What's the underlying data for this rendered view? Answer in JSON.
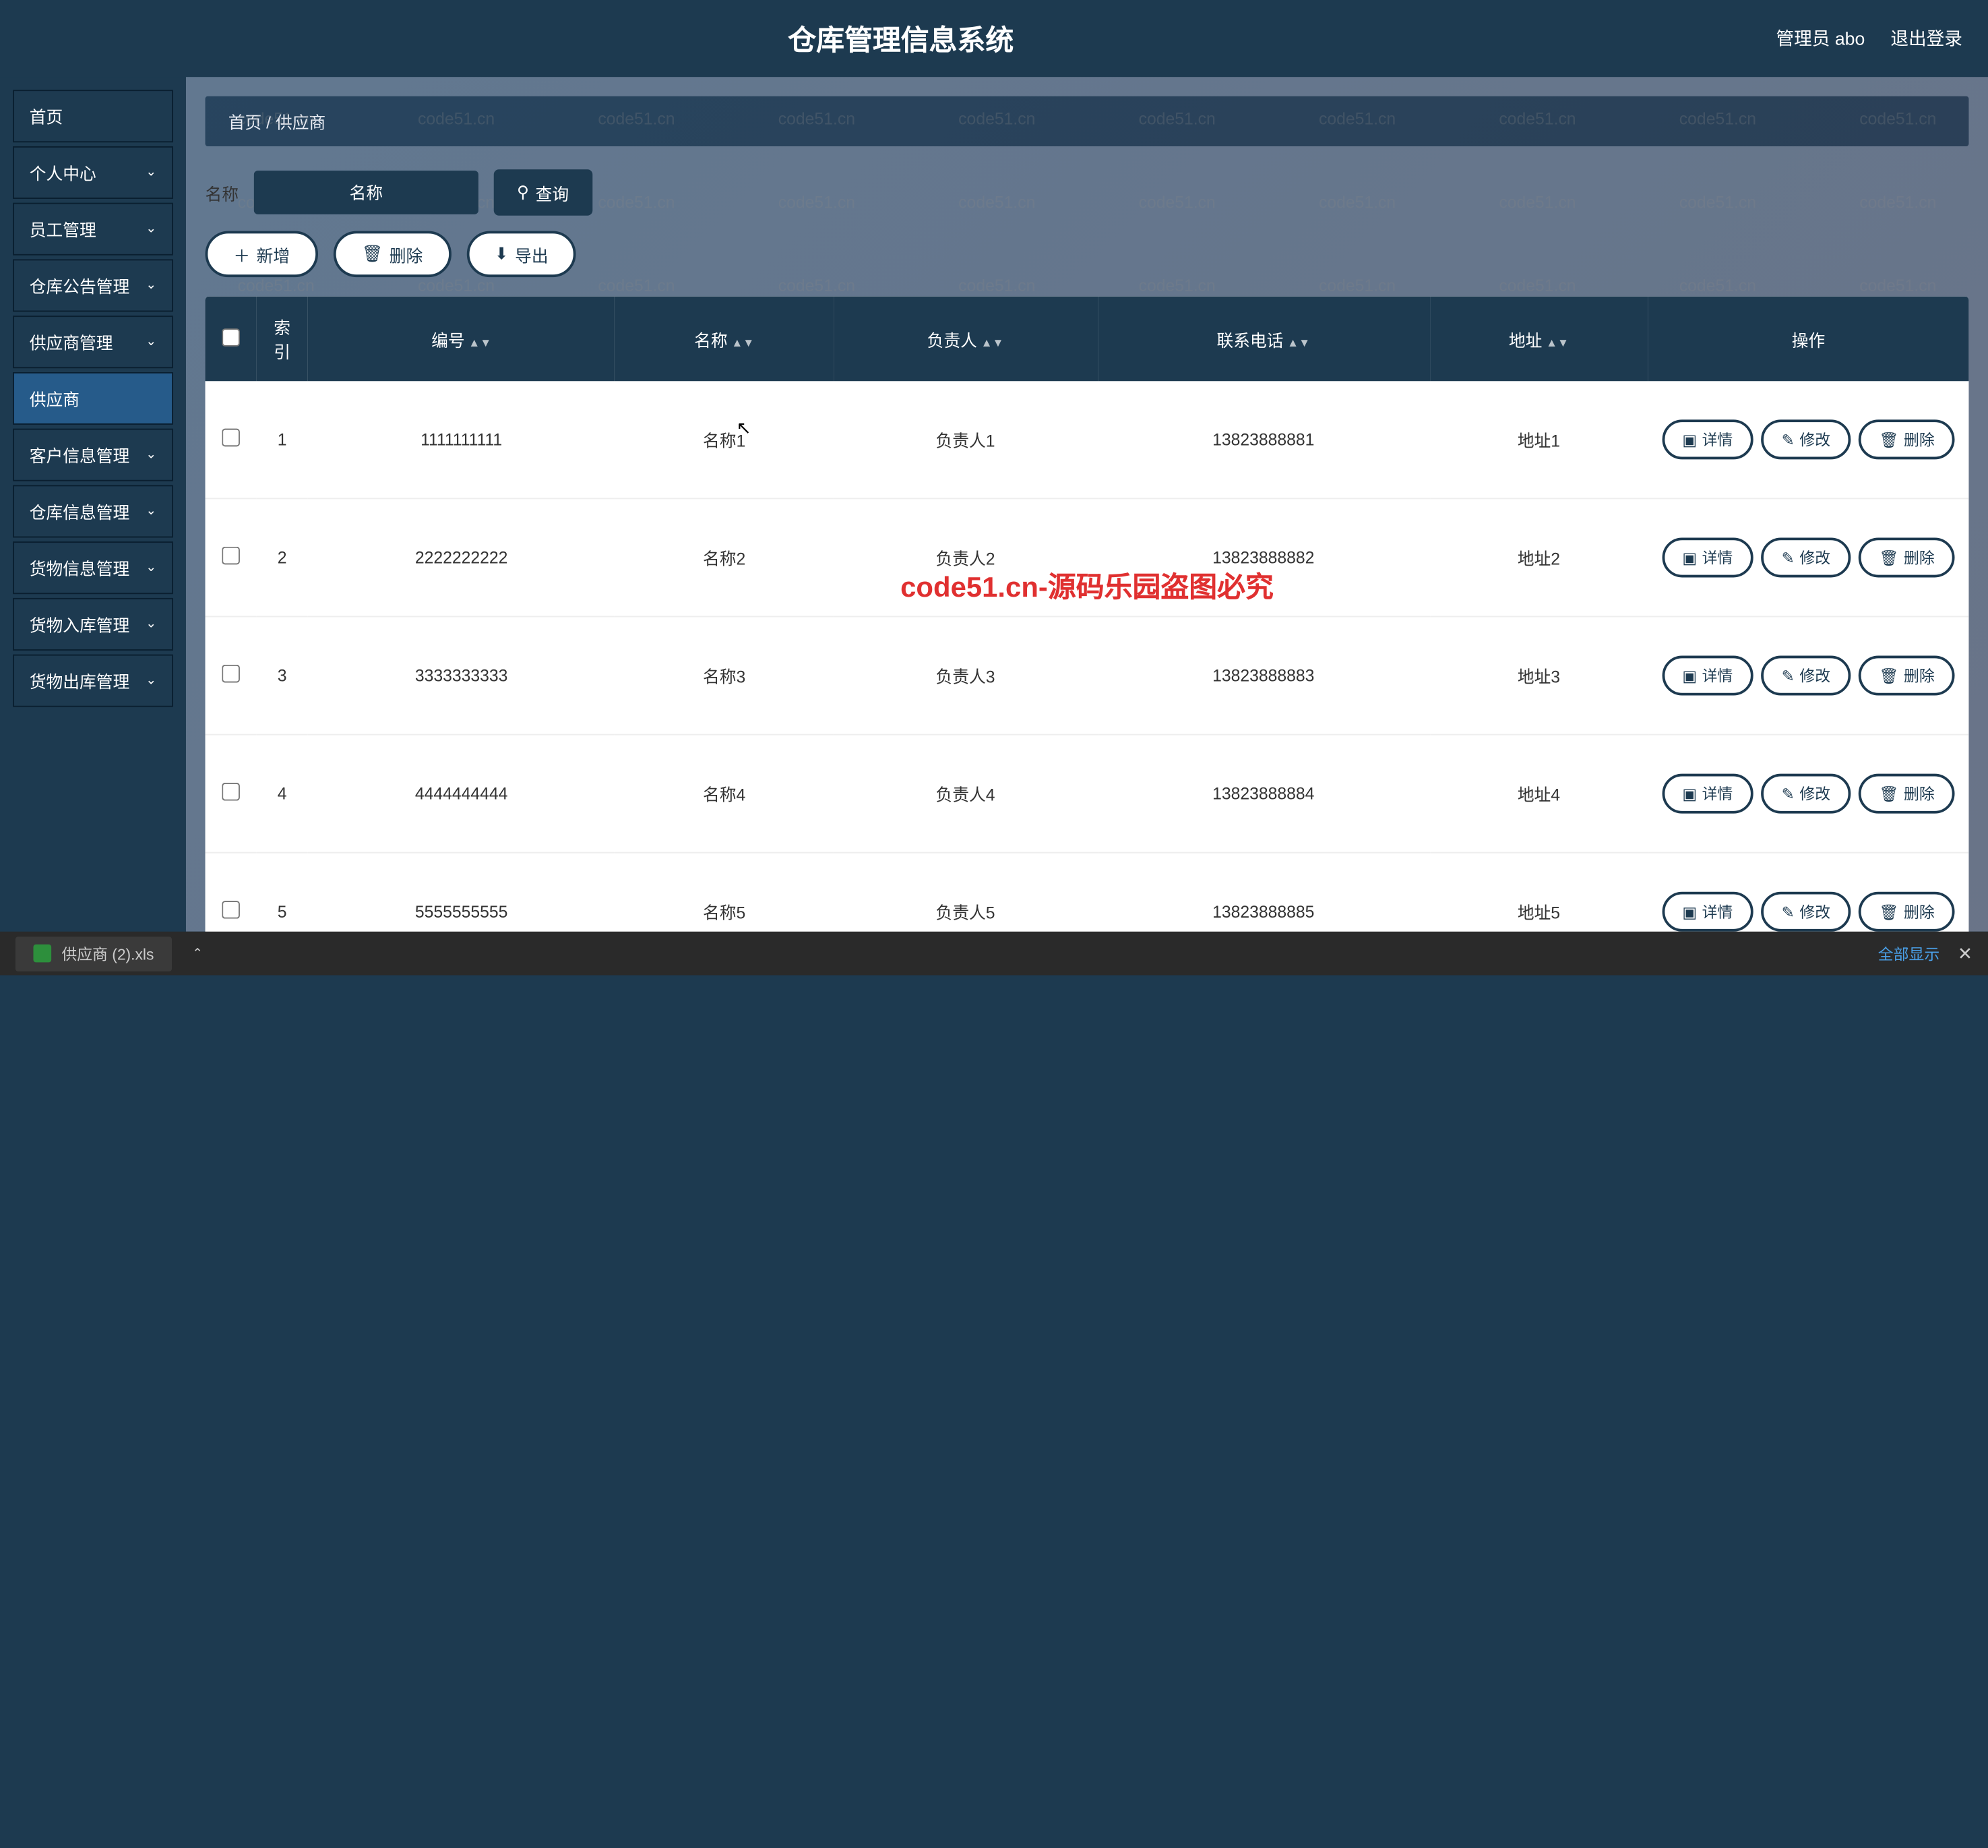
{
  "header": {
    "title": "仓库管理信息系统",
    "user_label": "管理员 abo",
    "logout": "退出登录"
  },
  "sidebar": {
    "items": [
      {
        "label": "首页",
        "expandable": false
      },
      {
        "label": "个人中心",
        "expandable": true
      },
      {
        "label": "员工管理",
        "expandable": true
      },
      {
        "label": "仓库公告管理",
        "expandable": true
      },
      {
        "label": "供应商管理",
        "expandable": true,
        "expanded": true,
        "sub": [
          {
            "label": "供应商"
          }
        ]
      },
      {
        "label": "客户信息管理",
        "expandable": true
      },
      {
        "label": "仓库信息管理",
        "expandable": true
      },
      {
        "label": "货物信息管理",
        "expandable": true
      },
      {
        "label": "货物入库管理",
        "expandable": true
      },
      {
        "label": "货物出库管理",
        "expandable": true
      }
    ]
  },
  "breadcrumb": {
    "home": "首页",
    "sep": "/",
    "current": "供应商"
  },
  "filter": {
    "label": "名称",
    "placeholder": "名称",
    "query_btn": "查询"
  },
  "actions": {
    "add": "新增",
    "delete": "删除",
    "export": "导出"
  },
  "table": {
    "headers": {
      "index": "索引",
      "code": "编号",
      "name": "名称",
      "owner": "负责人",
      "phone": "联系电话",
      "address": "地址",
      "ops": "操作"
    },
    "op_labels": {
      "detail": "详情",
      "edit": "修改",
      "delete": "删除"
    },
    "rows": [
      {
        "index": "1",
        "code": "1111111111",
        "name": "名称1",
        "owner": "负责人1",
        "phone": "13823888881",
        "address": "地址1"
      },
      {
        "index": "2",
        "code": "2222222222",
        "name": "名称2",
        "owner": "负责人2",
        "phone": "13823888882",
        "address": "地址2"
      },
      {
        "index": "3",
        "code": "3333333333",
        "name": "名称3",
        "owner": "负责人3",
        "phone": "13823888883",
        "address": "地址3"
      },
      {
        "index": "4",
        "code": "4444444444",
        "name": "名称4",
        "owner": "负责人4",
        "phone": "13823888884",
        "address": "地址4"
      },
      {
        "index": "5",
        "code": "5555555555",
        "name": "名称5",
        "owner": "负责人5",
        "phone": "13823888885",
        "address": "地址5"
      }
    ]
  },
  "download_bar": {
    "filename": "供应商 (2).xls",
    "show_all": "全部显示"
  },
  "watermark": {
    "text": "code51.cn",
    "center": "code51.cn-源码乐园盗图必究"
  }
}
